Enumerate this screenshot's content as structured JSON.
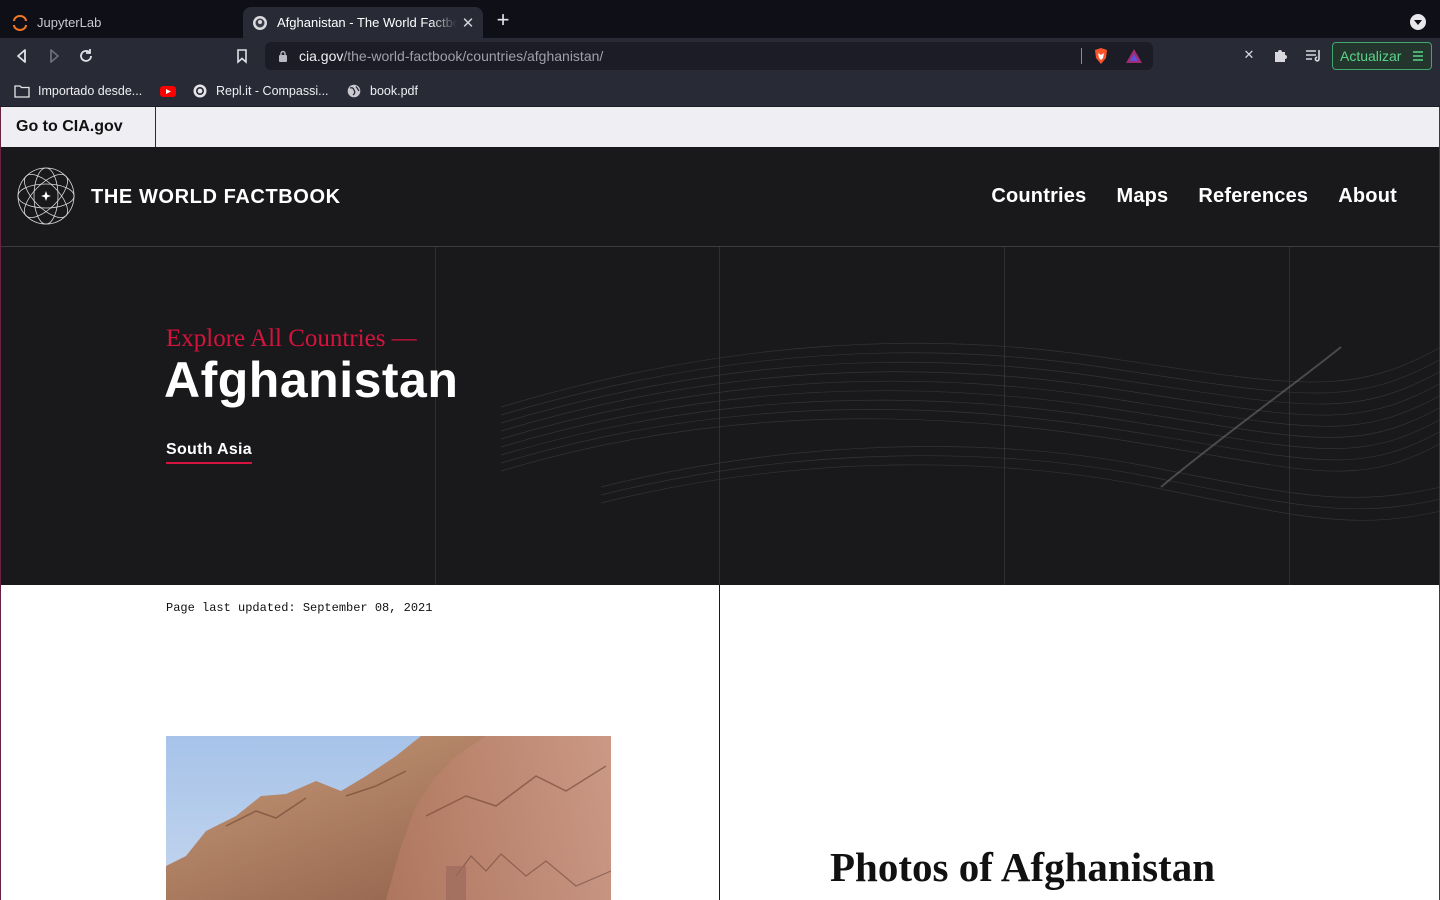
{
  "browser": {
    "tabs": [
      {
        "title": "JupyterLab",
        "active": false
      },
      {
        "title": "Afghanistan - The World Factbook",
        "active": true
      }
    ],
    "url_host": "cia.gov",
    "url_path": "/the-world-factbook/countries/afghanistan/",
    "update_button": "Actualizar",
    "bookmarks": [
      {
        "label": "Importado desde...",
        "icon": "folder-icon"
      },
      {
        "label": "",
        "icon": "youtube-icon"
      },
      {
        "label": "Repl.it - Compassi...",
        "icon": "replit-icon"
      },
      {
        "label": "book.pdf",
        "icon": "globe-icon"
      }
    ],
    "colors": {
      "tabbar": "#0e0f17",
      "toolbar": "#282a36",
      "accent_green": "#5bd38a"
    }
  },
  "site": {
    "skip_link": "Go to CIA.gov",
    "name": "THE WORLD FACTBOOK",
    "nav": [
      "Countries",
      "Maps",
      "References",
      "About"
    ],
    "colors": {
      "header_bg": "#19191b",
      "accent_red": "#d4143e"
    }
  },
  "hero": {
    "kicker": "Explore All Countries —",
    "title": "Afghanistan",
    "region": "South Asia"
  },
  "content": {
    "last_updated": "Page last updated: September 08, 2021",
    "photos_heading": "Photos of Afghanistan"
  }
}
